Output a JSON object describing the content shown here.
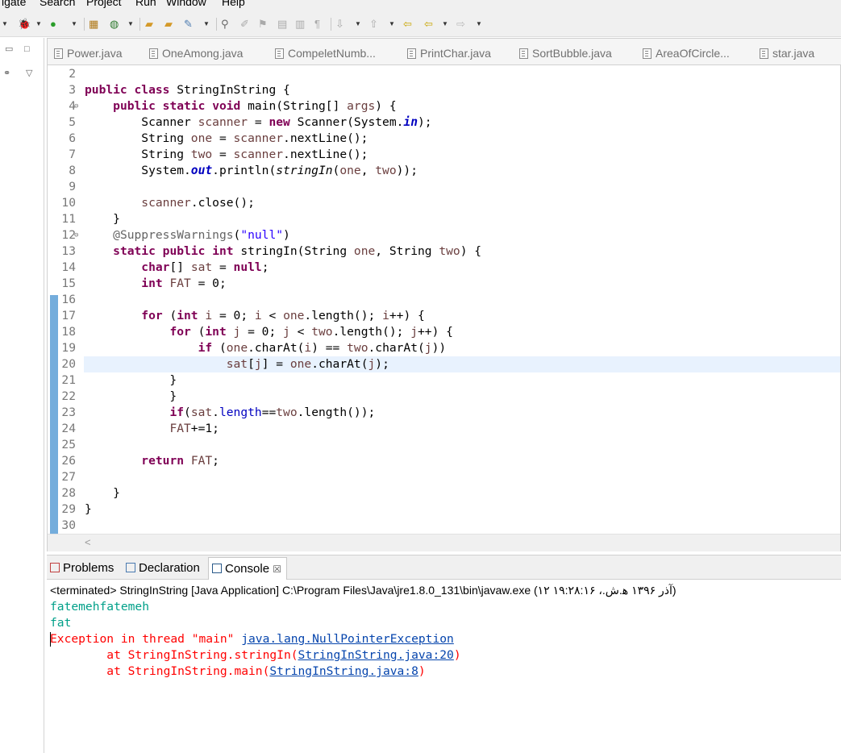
{
  "menu": [
    "igate",
    "Search",
    "Project",
    "Run",
    "Window",
    "Help"
  ],
  "editor": {
    "tabs": [
      "Power.java",
      "OneAmong.java",
      "CompeletNumb...",
      "PrintChar.java",
      "SortBubble.java",
      "AreaOfCircle...",
      "star.java"
    ],
    "lines": [
      {
        "n": "2",
        "code": ""
      },
      {
        "n": "3",
        "code": "public class StringInString {"
      },
      {
        "n": "4",
        "code": "    public static void main(String[] args) {",
        "fold": "⊖"
      },
      {
        "n": "5",
        "code": "        Scanner scanner = new Scanner(System.in);"
      },
      {
        "n": "6",
        "code": "        String one = scanner.nextLine();"
      },
      {
        "n": "7",
        "code": "        String two = scanner.nextLine();"
      },
      {
        "n": "8",
        "code": "        System.out.println(stringIn(one, two));"
      },
      {
        "n": "9",
        "code": ""
      },
      {
        "n": "10",
        "code": "        scanner.close();"
      },
      {
        "n": "11",
        "code": "    }"
      },
      {
        "n": "12",
        "code": "    @SuppressWarnings(\"null\")",
        "fold": "⊖"
      },
      {
        "n": "13",
        "code": "    static public int stringIn(String one, String two) {"
      },
      {
        "n": "14",
        "code": "        char[] sat = null;"
      },
      {
        "n": "15",
        "code": "        int FAT = 0;"
      },
      {
        "n": "16",
        "code": ""
      },
      {
        "n": "17",
        "code": "        for (int i = 0; i < one.length(); i++) {"
      },
      {
        "n": "18",
        "code": "            for (int j = 0; j < two.length(); j++) {"
      },
      {
        "n": "19",
        "code": "                if (one.charAt(i) == two.charAt(j))"
      },
      {
        "n": "20",
        "code": "                    sat[j] = one.charAt(j);"
      },
      {
        "n": "21",
        "code": "            }"
      },
      {
        "n": "22",
        "code": "            }"
      },
      {
        "n": "23",
        "code": "            if(sat.length==two.length());"
      },
      {
        "n": "24",
        "code": "            FAT+=1;"
      },
      {
        "n": "25",
        "code": ""
      },
      {
        "n": "26",
        "code": "        return FAT;"
      },
      {
        "n": "27",
        "code": ""
      },
      {
        "n": "28",
        "code": "    }"
      },
      {
        "n": "29",
        "code": "}"
      },
      {
        "n": "30",
        "code": ""
      }
    ],
    "current_line": "20"
  },
  "panel": {
    "tabs": [
      "Problems",
      "Declaration",
      "Console"
    ],
    "active_tab": "Console",
    "close_glyph": "☒",
    "terminated": "<terminated> StringInString [Java Application] C:\\Program Files\\Java\\jre1.8.0_131\\bin\\javaw.exe (۱۲ آذر ۱۳۹۶ ه‍.ش.، ۱۹:۲۸:۱۶)",
    "input_lines": [
      "fatemehfatemeh",
      "fat"
    ],
    "exception_prefix": "Exception in thread \"main\" ",
    "exception_link": "java.lang.NullPointerException",
    "stack": [
      {
        "prefix": "        at StringInString.stringIn(",
        "link": "StringInString.java:20",
        "suffix": ")"
      },
      {
        "prefix": "        at StringInString.main(",
        "link": "StringInString.java:8",
        "suffix": ")"
      }
    ]
  },
  "colors": {
    "keyword": "#7f0055",
    "string": "#2a00ff",
    "field": "#0000c0",
    "console_input": "#00a089",
    "error": "#ff0000",
    "link": "#0645ad",
    "current_line": "#e8f2fe"
  },
  "icons": [
    "debug-icon",
    "run-icon",
    "coverage-icon",
    "new-package-icon",
    "new-class-icon",
    "open-folder-icon",
    "open-type-icon",
    "tools-icon",
    "pin-icon",
    "search-icon",
    "nav-back-icon",
    "nav-forward-icon"
  ]
}
